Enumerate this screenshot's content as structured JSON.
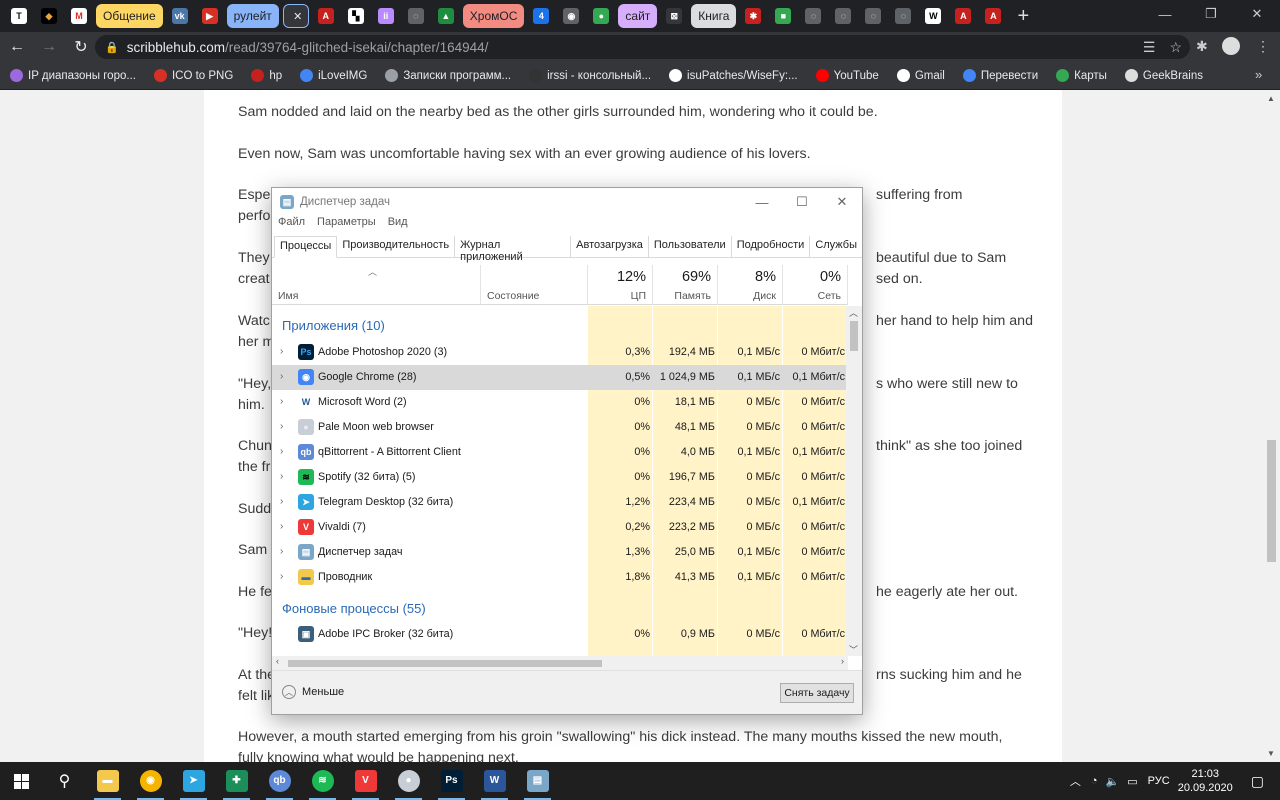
{
  "tabs": [
    {
      "label": "",
      "color": "#ffffff",
      "glyph": "T",
      "fg": "#111"
    },
    {
      "label": "",
      "color": "#000000",
      "glyph": "◆",
      "fg": "#e9a33a"
    },
    {
      "label": "",
      "color": "#ffffff",
      "glyph": "M",
      "fg": "#d93025"
    },
    {
      "label": "Общение",
      "color": "#fdd663",
      "group": true
    },
    {
      "label": "",
      "color": "#4a76a8",
      "glyph": "vk"
    },
    {
      "label": "",
      "color": "#d93025",
      "glyph": "▶"
    },
    {
      "label": "рулейт",
      "color": "#8ab4f8",
      "group": true
    },
    {
      "label": "",
      "color": "#202124",
      "glyph": "×",
      "active": true
    },
    {
      "label": "",
      "color": "#c5221f",
      "glyph": "A"
    },
    {
      "label": "",
      "color": "#ffffff",
      "glyph": "▚",
      "fg": "#000"
    },
    {
      "label": "",
      "color": "#b88cff",
      "glyph": "ii"
    },
    {
      "label": "",
      "color": "#5f6368",
      "glyph": "◌"
    },
    {
      "label": "",
      "color": "#1e8e3e",
      "glyph": "▲"
    },
    {
      "label": "ХромОС",
      "color": "#f28b82",
      "group": true
    },
    {
      "label": "",
      "color": "#1a73e8",
      "glyph": "4"
    },
    {
      "label": "",
      "color": "#5f6368",
      "glyph": "◉"
    },
    {
      "label": "",
      "color": "#34a853",
      "glyph": "●"
    },
    {
      "label": "сайт",
      "color": "#d7aefb",
      "group": true
    },
    {
      "label": "",
      "color": "#35363a",
      "glyph": "⊠"
    },
    {
      "label": "Книга",
      "color": "#dadce0",
      "group": true
    },
    {
      "label": "",
      "color": "#c5221f",
      "glyph": "✱"
    },
    {
      "label": "",
      "color": "#34a853",
      "glyph": "■"
    },
    {
      "label": "",
      "color": "#5f6368",
      "glyph": "◌"
    },
    {
      "label": "",
      "color": "#5f6368",
      "glyph": "◌"
    },
    {
      "label": "",
      "color": "#5f6368",
      "glyph": "◌"
    },
    {
      "label": "",
      "color": "#5f6368",
      "glyph": "◌"
    },
    {
      "label": "",
      "color": "#ffffff",
      "glyph": "W",
      "fg": "#000"
    },
    {
      "label": "",
      "color": "#c5221f",
      "glyph": "A"
    },
    {
      "label": "",
      "color": "#c5221f",
      "glyph": "A"
    }
  ],
  "address": {
    "host": "scribblehub.com",
    "path": "/read/39764-glitched-isekai/chapter/164944/"
  },
  "bookmarks": [
    {
      "label": "IP диапазоны горо...",
      "color": "#9c6ade"
    },
    {
      "label": "ICO to PNG",
      "color": "#d93025"
    },
    {
      "label": "hp",
      "color": "#c5221f"
    },
    {
      "label": "iLoveIMG",
      "color": "#4285f4"
    },
    {
      "label": "Записки программ...",
      "color": "#9aa0a6"
    },
    {
      "label": "irssi - консольный...",
      "color": "#333333"
    },
    {
      "label": "isuPatches/WiseFy:...",
      "color": "#ffffff"
    },
    {
      "label": "YouTube",
      "color": "#ff0000"
    },
    {
      "label": "Gmail",
      "color": "#ffffff"
    },
    {
      "label": "Перевести",
      "color": "#4285f4"
    },
    {
      "label": "Карты",
      "color": "#34a853"
    },
    {
      "label": "GeekBrains",
      "color": "#dddddd"
    }
  ],
  "article": [
    "Sam nodded and laid on the nearby bed as the other girls surrounded him, wondering who it could be.",
    "Even now, Sam was uncomfortable having sex with an ever growing audience of his lovers.",
    "Espec",
    "perfo",
    "suffering from",
    "They",
    "creat",
    "beautiful due to Sam",
    "sed on.",
    "Watc",
    "her m",
    "her hand to help him and",
    "\"Hey,",
    "him.",
    "s who were still new to",
    "Chun",
    "the fr",
    "think\" as she too joined",
    "Sudd",
    "Sam c",
    "He fe",
    "he eagerly ate her out.",
    "\"Hey!",
    "At the",
    "felt lik",
    "rns sucking him and he",
    "However, a mouth started emerging from his groin \"swallowing\" his dick instead. The many mouths kissed the new mouth,",
    "fully knowing what would be happening next."
  ],
  "taskmgr": {
    "title": "Диспетчер задач",
    "menu": [
      "Файл",
      "Параметры",
      "Вид"
    ],
    "tabs": [
      "Процессы",
      "Производительность",
      "Журнал приложений",
      "Автозагрузка",
      "Пользователи",
      "Подробности",
      "Службы"
    ],
    "columns": {
      "name": "Имя",
      "status": "Состояние",
      "cpu": {
        "pct": "12%",
        "label": "ЦП"
      },
      "mem": {
        "pct": "69%",
        "label": "Память"
      },
      "disk": {
        "pct": "8%",
        "label": "Диск"
      },
      "net": {
        "pct": "0%",
        "label": "Сеть"
      }
    },
    "section_apps": "Приложения (10)",
    "section_bg": "Фоновые процессы (55)",
    "apps": [
      {
        "name": "Adobe Photoshop 2020 (3)",
        "cpu": "0,3%",
        "mem": "192,4 МБ",
        "disk": "0,1 МБ/с",
        "net": "0 Мбит/с",
        "icon": "#001e36",
        "glyph": "Ps",
        "gfg": "#31a8ff"
      },
      {
        "name": "Google Chrome (28)",
        "cpu": "0,5%",
        "mem": "1 024,9 МБ",
        "disk": "0,1 МБ/с",
        "net": "0,1 Мбит/с",
        "icon": "#4285f4",
        "glyph": "◉",
        "selected": true
      },
      {
        "name": "Microsoft Word (2)",
        "cpu": "0%",
        "mem": "18,1 МБ",
        "disk": "0 МБ/с",
        "net": "0 Мбит/с",
        "icon": "#ffffff",
        "glyph": "W",
        "gfg": "#2b579a"
      },
      {
        "name": "Pale Moon web browser",
        "cpu": "0%",
        "mem": "48,1 МБ",
        "disk": "0 МБ/с",
        "net": "0 Мбит/с",
        "icon": "#c8ced6",
        "glyph": "●",
        "gfg": "#e8ecf0"
      },
      {
        "name": "qBittorrent - A Bittorrent Client",
        "cpu": "0%",
        "mem": "4,0 МБ",
        "disk": "0,1 МБ/с",
        "net": "0,1 Мбит/с",
        "icon": "#5d8ad8",
        "glyph": "qb"
      },
      {
        "name": "Spotify (32 бита) (5)",
        "cpu": "0%",
        "mem": "196,7 МБ",
        "disk": "0 МБ/с",
        "net": "0 Мбит/с",
        "icon": "#1db954",
        "glyph": "≋",
        "gfg": "#000"
      },
      {
        "name": "Telegram Desktop (32 бита)",
        "cpu": "1,2%",
        "mem": "223,4 МБ",
        "disk": "0 МБ/с",
        "net": "0,1 Мбит/с",
        "icon": "#2ca5e0",
        "glyph": "➤"
      },
      {
        "name": "Vivaldi (7)",
        "cpu": "0,2%",
        "mem": "223,2 МБ",
        "disk": "0 МБ/с",
        "net": "0 Мбит/с",
        "icon": "#ef3939",
        "glyph": "V"
      },
      {
        "name": "Диспетчер задач",
        "cpu": "1,3%",
        "mem": "25,0 МБ",
        "disk": "0,1 МБ/с",
        "net": "0 Мбит/с",
        "icon": "#7aa7c7",
        "glyph": "▤"
      },
      {
        "name": "Проводник",
        "cpu": "1,8%",
        "mem": "41,3 МБ",
        "disk": "0,1 МБ/с",
        "net": "0 Мбит/с",
        "icon": "#f2c94c",
        "glyph": "▬",
        "gfg": "#2b6cb0"
      }
    ],
    "bg": [
      {
        "name": "Adobe IPC Broker (32 бита)",
        "cpu": "0%",
        "mem": "0,9 МБ",
        "disk": "0 МБ/с",
        "net": "0 Мбит/с",
        "icon": "#3b5f7a",
        "glyph": "▣"
      }
    ],
    "less_label": "Меньше",
    "end_task_label": "Снять задачу"
  },
  "taskbar": [
    {
      "name": "explorer",
      "color": "#f2c94c",
      "glyph": "▬",
      "run": true
    },
    {
      "name": "chrome-canary",
      "color": "#f4b400",
      "glyph": "◉",
      "run": true
    },
    {
      "name": "telegram",
      "color": "#2ca5e0",
      "glyph": "➤",
      "run": true
    },
    {
      "name": "app-green",
      "color": "#1b8e5a",
      "glyph": "✚",
      "run": true
    },
    {
      "name": "qbittorrent",
      "color": "#5d8ad8",
      "glyph": "qb",
      "run": true
    },
    {
      "name": "spotify",
      "color": "#1db954",
      "glyph": "≋",
      "run": true
    },
    {
      "name": "vivaldi",
      "color": "#ef3939",
      "glyph": "V",
      "run": true
    },
    {
      "name": "palemoon",
      "color": "#c8ced6",
      "glyph": "●",
      "run": true
    },
    {
      "name": "photoshop",
      "color": "#001e36",
      "glyph": "Ps",
      "run": true
    },
    {
      "name": "word",
      "color": "#2b579a",
      "glyph": "W",
      "run": true
    },
    {
      "name": "taskmgr",
      "color": "#7aa7c7",
      "glyph": "▤",
      "run": true
    }
  ],
  "tray": {
    "lang": "РУС",
    "time": "21:03",
    "date": "20.09.2020"
  }
}
